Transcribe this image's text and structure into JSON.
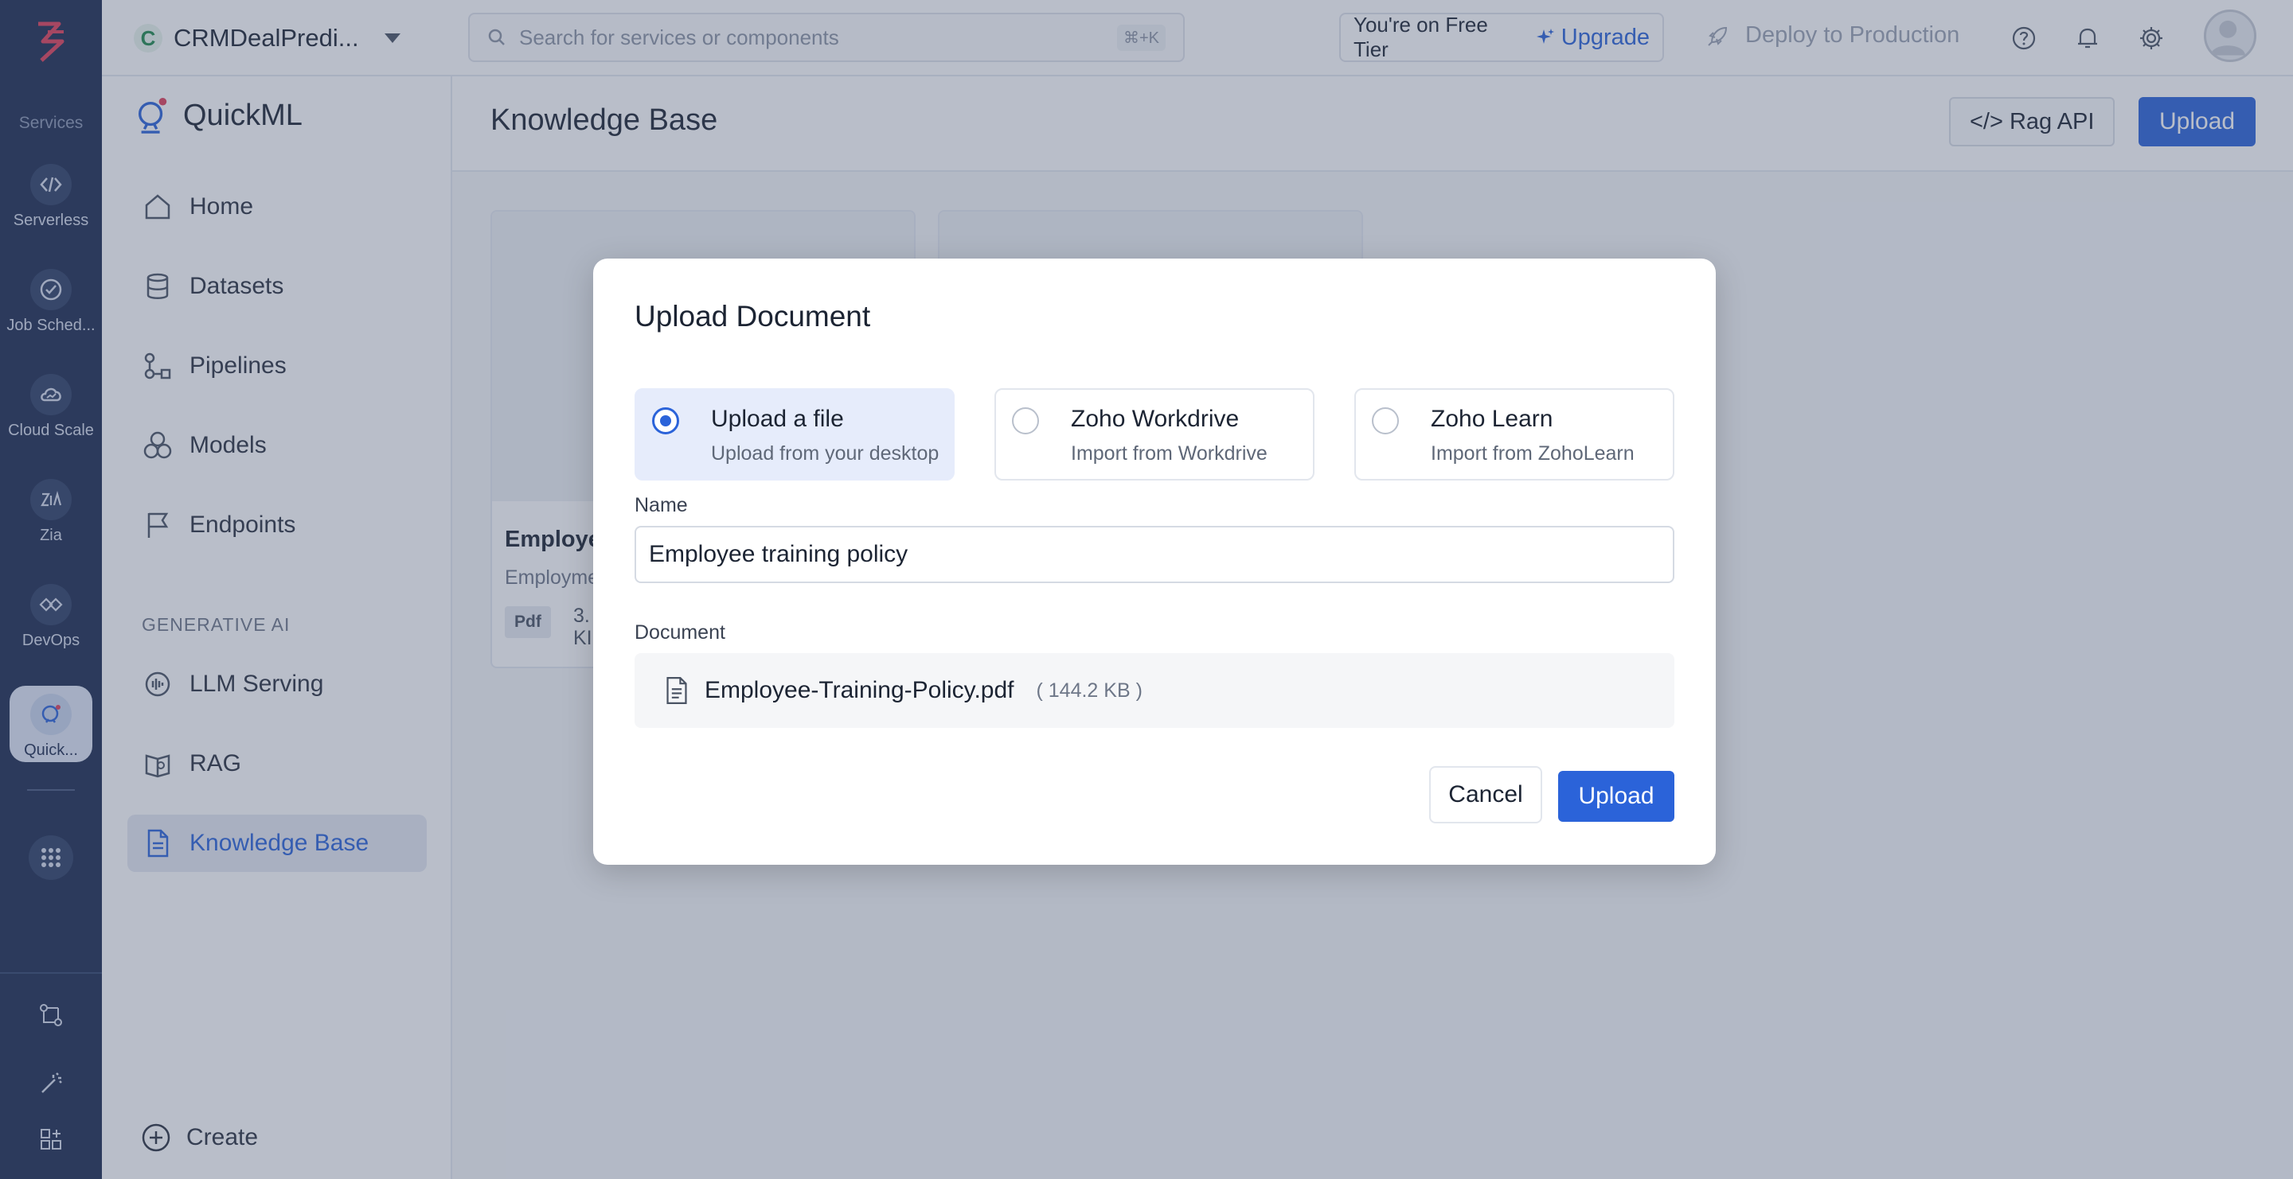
{
  "rail": {
    "section_label": "Services",
    "items": [
      {
        "label": "Serverless",
        "icon": "serverless-icon"
      },
      {
        "label": "Job Sched...",
        "icon": "job-scheduling-icon"
      },
      {
        "label": "Cloud Scale",
        "icon": "cloud-scale-icon"
      },
      {
        "label": "Zia",
        "icon": "zia-icon"
      },
      {
        "label": "DevOps",
        "icon": "devops-icon"
      },
      {
        "label": "Quick...",
        "icon": "quickml-icon",
        "active": true
      }
    ]
  },
  "header": {
    "project_initial": "C",
    "project_name": "CRMDealPredi...",
    "search_placeholder": "Search for services or components",
    "search_shortcut": "⌘+K",
    "tier_text": "You're on Free Tier",
    "upgrade_label": "Upgrade",
    "deploy_label": "Deploy to Production"
  },
  "sidenav": {
    "brand": "QuickML",
    "items": [
      {
        "label": "Home",
        "icon": "home-icon"
      },
      {
        "label": "Datasets",
        "icon": "database-icon"
      },
      {
        "label": "Pipelines",
        "icon": "pipeline-icon"
      },
      {
        "label": "Models",
        "icon": "models-icon"
      },
      {
        "label": "Endpoints",
        "icon": "flag-icon"
      }
    ],
    "section_title": "GENERATIVE AI",
    "gen_items": [
      {
        "label": "LLM Serving",
        "icon": "llm-icon"
      },
      {
        "label": "RAG",
        "icon": "rag-icon"
      },
      {
        "label": "Knowledge Base",
        "icon": "document-icon",
        "active": true
      }
    ],
    "create_label": "Create"
  },
  "main": {
    "title": "Knowledge Base",
    "rag_api_label": "</> Rag API",
    "upload_label": "Upload",
    "card": {
      "title": "Employe",
      "subtitle": "Employme",
      "tag": "Pdf",
      "size_line1": "3.",
      "size_line2": "KI"
    }
  },
  "modal": {
    "title": "Upload Document",
    "options": [
      {
        "title": "Upload a file",
        "subtitle": "Upload from your desktop",
        "selected": true
      },
      {
        "title": "Zoho Workdrive",
        "subtitle": "Import from Workdrive",
        "selected": false
      },
      {
        "title": "Zoho Learn",
        "subtitle": "Import from ZohoLearn",
        "selected": false
      }
    ],
    "name_label": "Name",
    "name_value": "Employee training policy",
    "document_label": "Document",
    "file_name": "Employee-Training-Policy.pdf",
    "file_size": "( 144.2 KB )",
    "cancel_label": "Cancel",
    "upload_label": "Upload"
  },
  "colors": {
    "accent": "#2b63d9",
    "rail_bg": "#1c2b4f",
    "overlay": "#465472"
  }
}
